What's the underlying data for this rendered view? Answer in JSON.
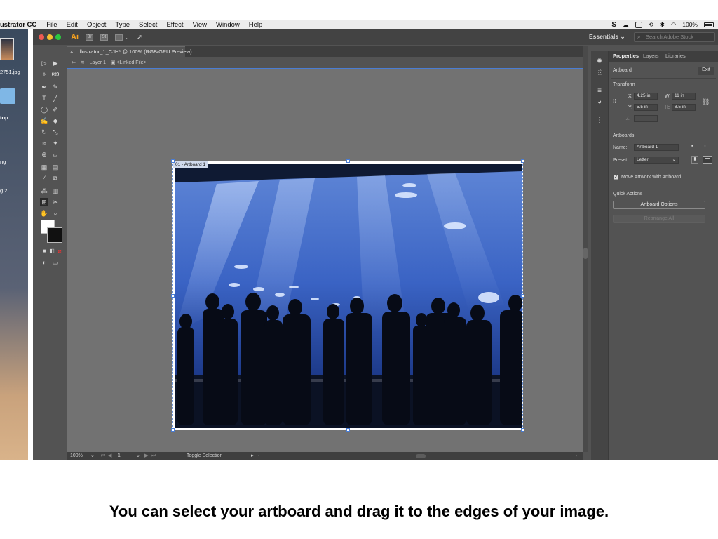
{
  "menubar": {
    "app_name": "ustrator CC",
    "items": [
      "File",
      "Edit",
      "Object",
      "Type",
      "Select",
      "Effect",
      "View",
      "Window",
      "Help"
    ],
    "status_battery": "100%"
  },
  "desktop": {
    "file_label": "2751.jpg",
    "desktop_label": "top",
    "item_label_1": "ng",
    "item_label_2": "g 2"
  },
  "app": {
    "logo": "Ai",
    "appbar_icon_br": "Br",
    "appbar_icon_st": "St",
    "workspace": "Essentials",
    "search_placeholder": "Search Adobe Stock"
  },
  "document": {
    "tab_title": "Illustrator_1_CJH* @ 100% (RGB/GPU Preview)",
    "tab_close": "×",
    "layer": "Layer 1",
    "linked_file": "<Linked File>",
    "artboard_label": "01 - Artboard 1"
  },
  "statusbar": {
    "zoom": "100%",
    "artboard_number": "1",
    "tool_status": "Toggle Selection"
  },
  "properties": {
    "tabs": [
      "Properties",
      "Layers",
      "Libraries"
    ],
    "section_artboard": "Artboard",
    "exit_label": "Exit",
    "section_transform": "Transform",
    "x_label": "X:",
    "x_value": "4.25 in",
    "y_label": "Y:",
    "y_value": "5.5 in",
    "w_label": "W:",
    "w_value": "11 in",
    "h_label": "H:",
    "h_value": "8.5 in",
    "section_artboards": "Artboards",
    "name_label": "Name:",
    "name_value": "Artboard 1",
    "preset_label": "Preset:",
    "preset_value": "Letter",
    "move_artwork_label": "Move Artwork with Artboard",
    "move_artwork_checked": true,
    "section_quick_actions": "Quick Actions",
    "artboard_options_label": "Artboard Options",
    "rearrange_all_label": "Rearrange All"
  },
  "caption": "You can select your artboard and drag it to the edges of your image."
}
